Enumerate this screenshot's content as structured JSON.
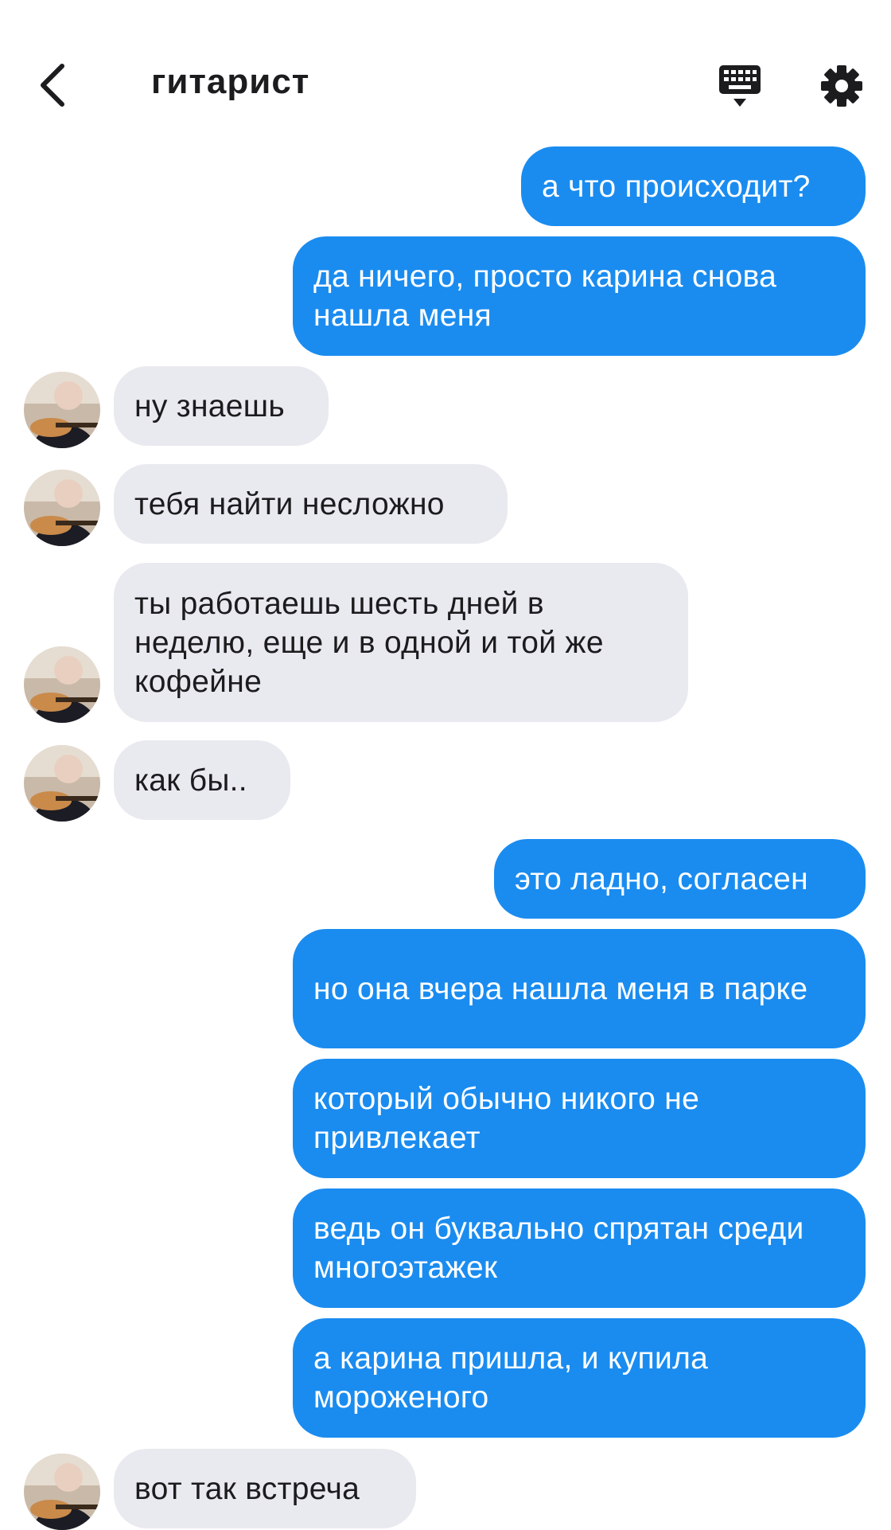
{
  "header": {
    "title": "гитарист",
    "back_icon": "chevron-left-icon",
    "keyboard_icon": "keyboard-icon",
    "settings_icon": "gear-icon"
  },
  "colors": {
    "outgoing_bubble": "#1a8cf0",
    "incoming_bubble": "#e9e9f0",
    "text_dark": "#1c1c1e"
  },
  "messages": [
    {
      "direction": "out",
      "text": "а что происходит?"
    },
    {
      "direction": "out",
      "text": "да ничего, просто карина снова нашла меня"
    },
    {
      "direction": "in",
      "text": "ну знаешь"
    },
    {
      "direction": "in",
      "text": "тебя найти несложно"
    },
    {
      "direction": "in",
      "text": "ты работаешь шесть дней в неделю, еще и в одной и той же кофейне"
    },
    {
      "direction": "in",
      "text": "как бы.."
    },
    {
      "direction": "out",
      "text": "это ладно, согласен"
    },
    {
      "direction": "out",
      "text": "но она вчера нашла меня в парке"
    },
    {
      "direction": "out",
      "text": "который обычно никого не привлекает"
    },
    {
      "direction": "out",
      "text": "ведь он буквально спрятан среди многоэтажек"
    },
    {
      "direction": "out",
      "text": "а карина пришла, и купила мороженого"
    },
    {
      "direction": "in",
      "text": "вот так встреча"
    }
  ]
}
